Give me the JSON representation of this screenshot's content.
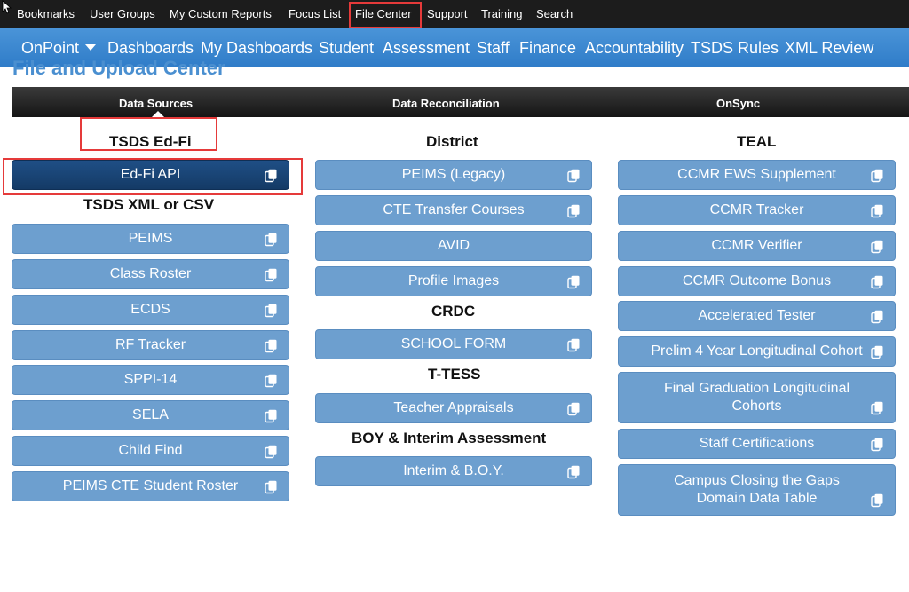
{
  "top_menu": [
    "Bookmarks",
    "User Groups",
    "My Custom Reports",
    "Focus List",
    "File Center",
    "Support",
    "Training",
    "Search"
  ],
  "nav": {
    "onpoint": "OnPoint",
    "items": [
      "Dashboards",
      "My Dashboards",
      "Student",
      "Assessment",
      "Staff",
      "Finance",
      "Accountability",
      "TSDS Rules",
      "XML Review"
    ]
  },
  "page_title": "File and Upload Center",
  "tabs": [
    "Data Sources",
    "Data Reconciliation",
    "OnSync"
  ],
  "col1": {
    "heading1": "TSDS Ed-Fi",
    "edfi_api": "Ed-Fi API",
    "heading2": "TSDS XML or CSV",
    "items": [
      "PEIMS",
      "Class Roster",
      "ECDS",
      "RF Tracker",
      "SPPI-14",
      "SELA",
      "Child Find",
      "PEIMS CTE Student Roster"
    ]
  },
  "col2": {
    "heading_district": "District",
    "district": [
      "PEIMS (Legacy)",
      "CTE Transfer Courses",
      "AVID",
      "Profile Images"
    ],
    "heading_crdc": "CRDC",
    "crdc": [
      "SCHOOL FORM"
    ],
    "heading_ttess": "T-TESS",
    "ttess": [
      "Teacher Appraisals"
    ],
    "heading_boy": "BOY & Interim Assessment",
    "boy": [
      "Interim & B.O.Y."
    ]
  },
  "col3": {
    "heading": "TEAL",
    "items": [
      "CCMR EWS Supplement",
      "CCMR Tracker",
      "CCMR Verifier",
      "CCMR Outcome Bonus",
      "Accelerated Tester",
      "Prelim 4 Year Longitudinal Cohort",
      "Final Graduation Longitudinal Cohorts",
      "Staff Certifications",
      "Campus Closing the Gaps Domain Data Table"
    ]
  },
  "colors": {
    "button": "#6d9fcf",
    "button_active": "#1f4f86",
    "highlight": "#e53a3a",
    "nav": "#3a88d0",
    "topbar": "#1c1c1c"
  }
}
